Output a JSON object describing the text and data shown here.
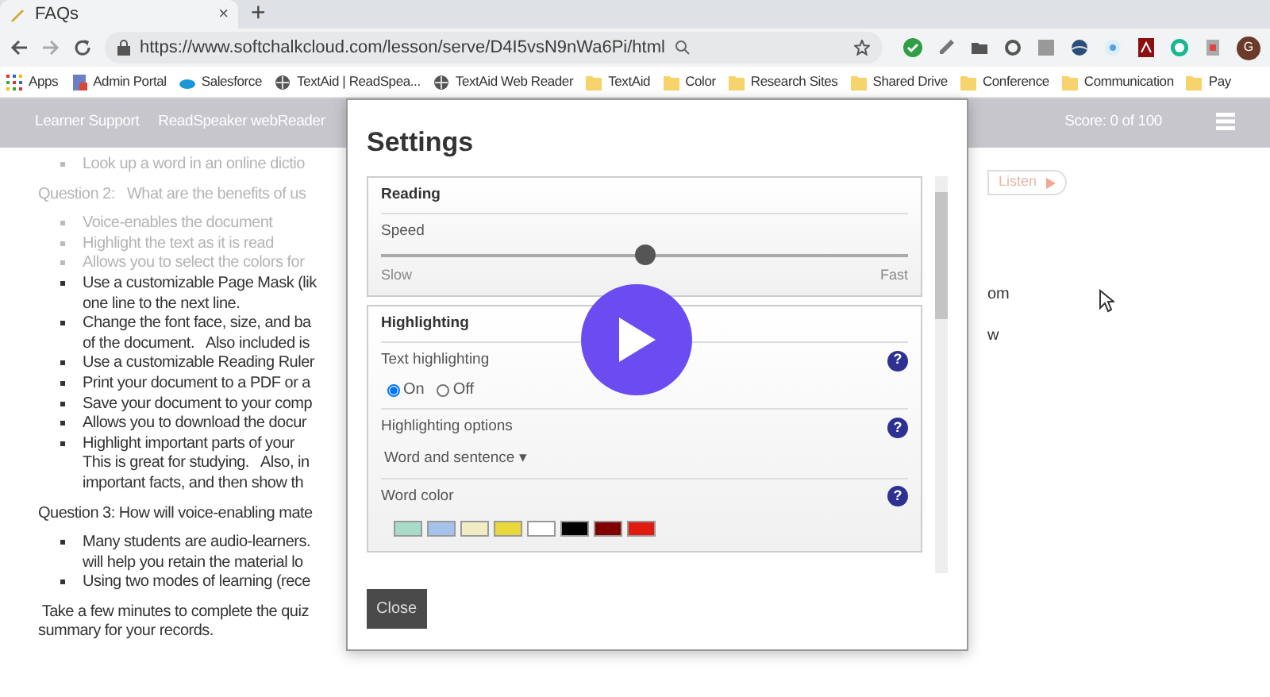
{
  "browser": {
    "tab": {
      "title": "FAQs",
      "close": "×"
    },
    "new_tab": "+",
    "url": "https://www.softchalkcloud.com/lesson/serve/D4I5vsN9nWa6Pi/html",
    "avatar_letter": "G",
    "bookmarks": [
      {
        "label": "Apps",
        "kind": "apps"
      },
      {
        "label": "Admin Portal",
        "kind": "page"
      },
      {
        "label": "Salesforce",
        "kind": "cloud"
      },
      {
        "label": "TextAid | ReadSpea...",
        "kind": "globe"
      },
      {
        "label": "TextAid Web Reader",
        "kind": "globe"
      },
      {
        "label": "TextAid",
        "kind": "folder"
      },
      {
        "label": "Color",
        "kind": "folder"
      },
      {
        "label": "Research Sites",
        "kind": "folder"
      },
      {
        "label": "Shared Drive",
        "kind": "folder"
      },
      {
        "label": "Conference",
        "kind": "folder"
      },
      {
        "label": "Communication",
        "kind": "folder"
      },
      {
        "label": "Pay",
        "kind": "folder"
      }
    ]
  },
  "header": {
    "links": [
      "Learner Support",
      "ReadSpeaker webReader"
    ],
    "score": "Score: 0 of 100"
  },
  "content": {
    "blocks": [
      {
        "kind": "bullet",
        "faded": true,
        "lines": [
          "Look up a word in an online dictio"
        ]
      },
      {
        "kind": "question",
        "faded": true,
        "lines": [
          "Question 2:   What are the benefits of us"
        ]
      },
      {
        "kind": "bullet",
        "faded": true,
        "lines": [
          "Voice-enables the document"
        ]
      },
      {
        "kind": "bullet",
        "faded": true,
        "lines": [
          "Highlight the text as it is read"
        ]
      },
      {
        "kind": "bullet",
        "faded": true,
        "lines": [
          "Allows you to select the colors for"
        ]
      },
      {
        "kind": "bullet",
        "faded": false,
        "lines": [
          "Use a customizable Page Mask (lik",
          "one line to the next line."
        ]
      },
      {
        "kind": "bullet",
        "faded": false,
        "lines": [
          "Change the font face, size, and ba",
          "of the document.   Also included is"
        ]
      },
      {
        "kind": "bullet",
        "faded": false,
        "lines": [
          "Use a customizable Reading Ruler"
        ]
      },
      {
        "kind": "bullet",
        "faded": false,
        "lines": [
          "Print your document to a PDF or a"
        ]
      },
      {
        "kind": "bullet",
        "faded": false,
        "lines": [
          "Save your document to your comp"
        ]
      },
      {
        "kind": "bullet",
        "faded": false,
        "lines": [
          "Allows you to download the docur"
        ]
      },
      {
        "kind": "bullet",
        "faded": false,
        "lines": [
          "Highlight important parts of your",
          "This is great for studying.   Also, in",
          "important facts, and then show th"
        ]
      },
      {
        "kind": "question",
        "faded": false,
        "lines": [
          "Question 3: How will voice-enabling mate"
        ]
      },
      {
        "kind": "bullet",
        "faded": false,
        "lines": [
          "Many students are audio-learners.",
          "will help you retain the material lo"
        ]
      },
      {
        "kind": "bullet",
        "faded": false,
        "lines": [
          "Using two modes of learning (rece"
        ]
      },
      {
        "kind": "paragraph",
        "faded": false,
        "lines": [
          " Take a few minutes to complete the quiz",
          "summary for your records."
        ]
      }
    ],
    "listen_button": "Listen",
    "fragments": [
      "om",
      "w"
    ]
  },
  "settings": {
    "title": "Settings",
    "reading": {
      "heading": "Reading",
      "speed_label": "Speed",
      "level": 0.5,
      "min_label": "Slow",
      "max_label": "Fast"
    },
    "highlighting": {
      "heading": "Highlighting",
      "text_highlighting": {
        "label": "Text highlighting",
        "help": "?",
        "options": [
          {
            "label": "On",
            "selected": true
          },
          {
            "label": "Off",
            "selected": false
          }
        ]
      },
      "options": {
        "label": "Highlighting options",
        "help": "?",
        "value": "Word and sentence",
        "caret": "▾"
      },
      "word_color": {
        "label": "Word color",
        "help": "?",
        "swatches": [
          {
            "color": "#a8dcc8"
          },
          {
            "color": "#a4c2ea"
          },
          {
            "color": "#f0ecc4"
          },
          {
            "color": "#e8d83c"
          },
          {
            "color": "#ffffff"
          },
          {
            "color": "#000000"
          },
          {
            "color": "#800000"
          },
          {
            "color": "#e01c10"
          }
        ]
      }
    },
    "close_button": "Close"
  }
}
